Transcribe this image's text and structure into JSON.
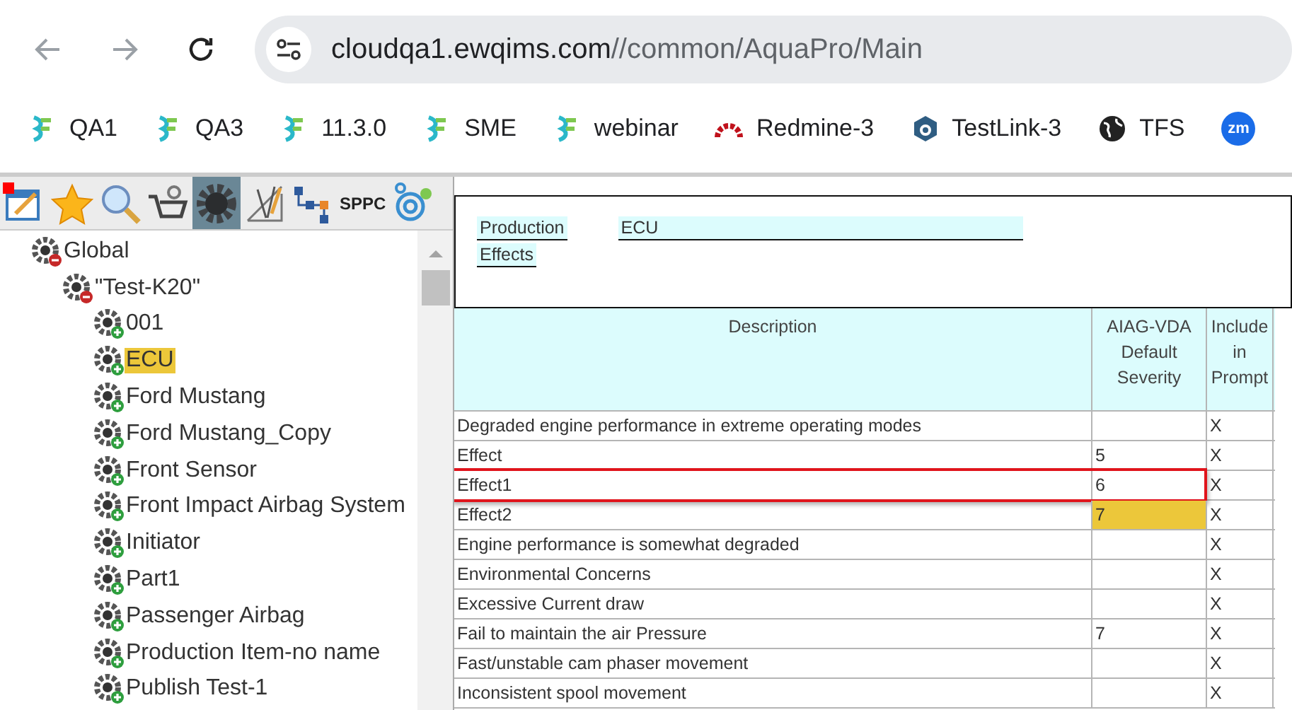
{
  "browser": {
    "url_host": "cloudqa1.ewqims.com",
    "url_path": "//common/AquaPro/Main"
  },
  "bookmarks": [
    {
      "kind": "logo",
      "label": "QA1"
    },
    {
      "kind": "logo",
      "label": "QA3"
    },
    {
      "kind": "logo",
      "label": "11.3.0"
    },
    {
      "kind": "logo",
      "label": "SME"
    },
    {
      "kind": "logo",
      "label": "webinar"
    },
    {
      "kind": "arc",
      "label": "Redmine-3"
    },
    {
      "kind": "hex",
      "label": "TestLink-3"
    },
    {
      "kind": "globe",
      "label": "TFS"
    },
    {
      "kind": "badge",
      "badge": "zm"
    }
  ],
  "toolbar": {
    "tools": [
      {
        "kind": "edit",
        "selected": false
      },
      {
        "kind": "star",
        "selected": false
      },
      {
        "kind": "search",
        "selected": false
      },
      {
        "kind": "cart",
        "selected": false
      },
      {
        "kind": "gear",
        "selected": true
      },
      {
        "kind": "drafting",
        "selected": false
      },
      {
        "kind": "flow",
        "selected": false
      },
      {
        "kind": "text",
        "label": "SPPC",
        "selected": false
      },
      {
        "kind": "rings",
        "selected": false
      }
    ]
  },
  "tree": [
    {
      "label": "Global",
      "expanded": true,
      "selected": false,
      "children": [
        {
          "label": "\"Test-K20\"",
          "expanded": true,
          "selected": false,
          "children": [
            {
              "label": "001",
              "expanded": false,
              "selected": false
            },
            {
              "label": "ECU",
              "expanded": false,
              "selected": true
            },
            {
              "label": "Ford Mustang",
              "expanded": false,
              "selected": false
            },
            {
              "label": "Ford Mustang_Copy",
              "expanded": false,
              "selected": false
            },
            {
              "label": "Front Sensor",
              "expanded": false,
              "selected": false
            },
            {
              "label": "Front Impact Airbag System",
              "expanded": false,
              "selected": false
            },
            {
              "label": "Initiator",
              "expanded": false,
              "selected": false
            },
            {
              "label": "Part1",
              "expanded": false,
              "selected": false
            },
            {
              "label": "Passenger Airbag",
              "expanded": false,
              "selected": false
            },
            {
              "label": "Production Item-no name",
              "expanded": false,
              "selected": false
            },
            {
              "label": "Publish Test-1",
              "expanded": false,
              "selected": false
            }
          ]
        }
      ]
    }
  ],
  "info": {
    "fields": [
      {
        "label": "Production",
        "value": "ECU"
      },
      {
        "label": "Effects"
      }
    ]
  },
  "table": {
    "columns": [
      "Description",
      "AIAG-VDA Default Severity",
      "Include in Prompt"
    ],
    "rows": [
      {
        "description": "Degraded engine performance in extreme operating modes",
        "include": "X",
        "highlighted": false,
        "outlined": false
      },
      {
        "description": "Effect",
        "severity": "5",
        "include": "X",
        "highlighted": false,
        "outlined": false
      },
      {
        "description": "Effect1",
        "severity": "6",
        "include": "X",
        "highlighted": false,
        "outlined": true
      },
      {
        "description": "Effect2",
        "severity": "7",
        "include": "X",
        "highlighted": true,
        "outlined": false
      },
      {
        "description": "Engine performance is somewhat degraded",
        "include": "X",
        "highlighted": false,
        "outlined": false
      },
      {
        "description": "Environmental Concerns",
        "include": "X",
        "highlighted": false,
        "outlined": false
      },
      {
        "description": "Excessive Current draw",
        "include": "X",
        "highlighted": false,
        "outlined": false
      },
      {
        "description": "Fail to maintain the air Pressure",
        "severity": "7",
        "include": "X",
        "highlighted": false,
        "outlined": false
      },
      {
        "description": "Fast/unstable cam phaser movement",
        "include": "X",
        "highlighted": false,
        "outlined": false
      },
      {
        "description": "Inconsistent spool movement",
        "include": "X",
        "highlighted": false,
        "outlined": false
      }
    ]
  }
}
